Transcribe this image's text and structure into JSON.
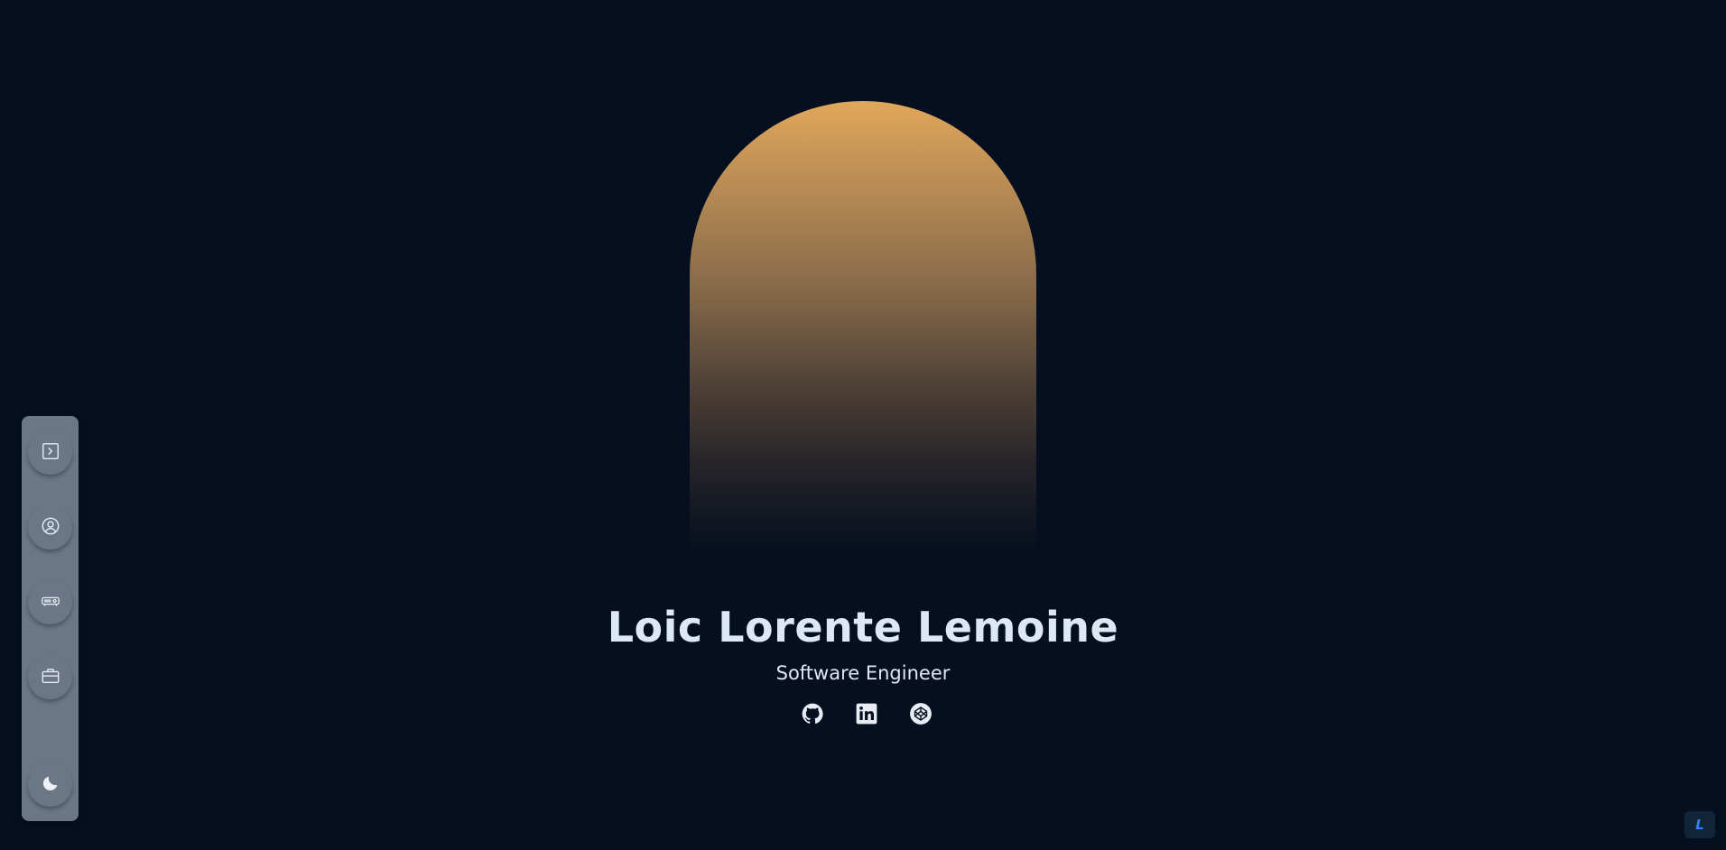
{
  "hero": {
    "name": "Loic Lorente Lemoine",
    "subtitle": "Software Engineer",
    "arch_gradient_top": "#e0a75a",
    "arch_gradient_bottom": "#060f1f"
  },
  "socials": [
    {
      "icon": "github-icon"
    },
    {
      "icon": "linkedin-icon"
    },
    {
      "icon": "codepen-icon"
    }
  ],
  "sidebar": {
    "items": [
      {
        "icon": "terminal-icon"
      },
      {
        "icon": "user-circle-icon"
      },
      {
        "icon": "projector-icon"
      },
      {
        "icon": "briefcase-icon"
      },
      {
        "icon": "moon-icon"
      }
    ]
  },
  "corner_badge": {
    "label": "L"
  },
  "colors": {
    "background": "#060f1f",
    "sidebar": "#6b7686",
    "text": "#dde8f7",
    "badge_accent": "#2f80ff"
  }
}
